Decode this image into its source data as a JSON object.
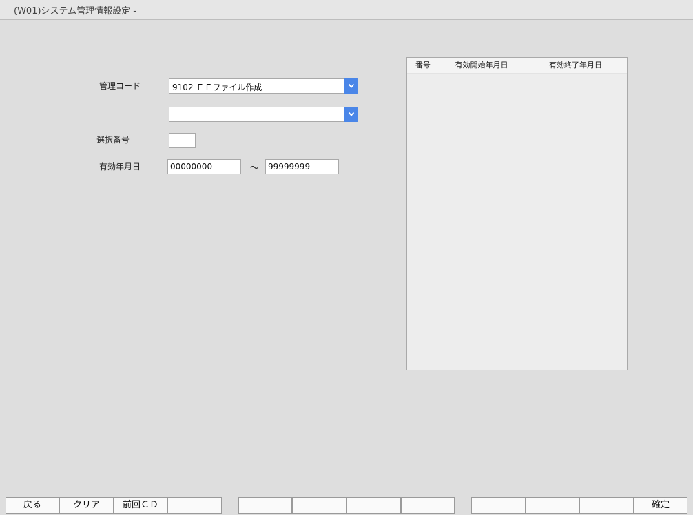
{
  "window": {
    "title": "(W01)システム管理情報設定 -"
  },
  "form": {
    "code_label": "管理コード",
    "code_value": "9102 ＥＦファイル作成",
    "sub_value": "",
    "select_label": "選択番号",
    "select_value": "",
    "date_label": "有効年月日",
    "date_from": "00000000",
    "tilde": "～",
    "date_to": "99999999"
  },
  "grid": {
    "columns": [
      "番号",
      "有効開始年月日",
      "有効終了年月日"
    ],
    "rows": []
  },
  "footer": {
    "buttons": [
      "戻る",
      "クリア",
      "前回ＣＤ",
      "",
      "",
      "",
      "",
      "",
      "",
      "",
      "",
      "確定"
    ]
  },
  "colors": {
    "dropdown_accent": "#4a86e8",
    "background": "#dedede"
  },
  "icons": {
    "dropdown": "chevron-down-icon"
  }
}
